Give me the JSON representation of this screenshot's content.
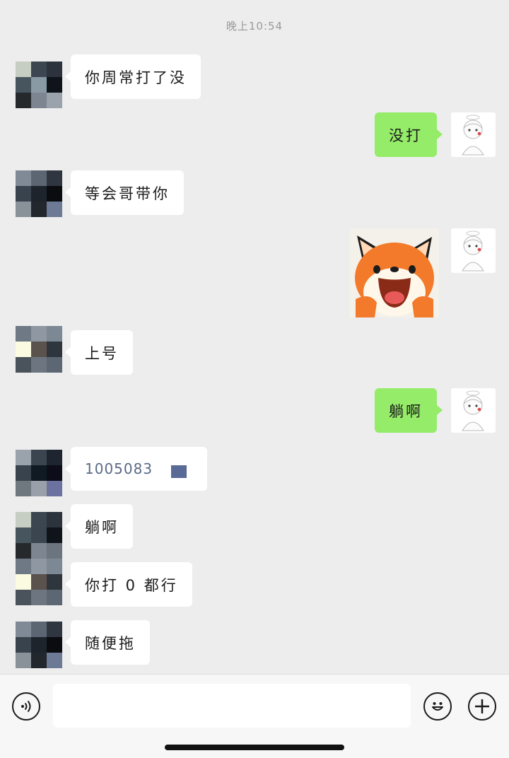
{
  "timestamp": "晚上10:54",
  "messages": [
    {
      "side": "left",
      "text": "你周常打了没"
    },
    {
      "side": "right",
      "text": "没打"
    },
    {
      "side": "left",
      "text": "等会哥带你"
    },
    {
      "side": "right",
      "type": "sticker",
      "sticker": "fox-face"
    },
    {
      "side": "left",
      "text": "上号"
    },
    {
      "side": "right",
      "text": "躺啊"
    },
    {
      "side": "left",
      "text": "1005083"
    },
    {
      "side": "left",
      "text": "躺啊"
    },
    {
      "side": "left",
      "text": "你打 0 都行"
    },
    {
      "side": "left",
      "text": "随便拖"
    }
  ],
  "input": {
    "value": "",
    "placeholder": ""
  },
  "icons": {
    "voice": "voice-icon",
    "emoji": "emoji-icon",
    "plus": "plus-icon"
  },
  "colors": {
    "my_bubble": "#95ec69",
    "their_bubble": "#ffffff",
    "background": "#ededed"
  }
}
